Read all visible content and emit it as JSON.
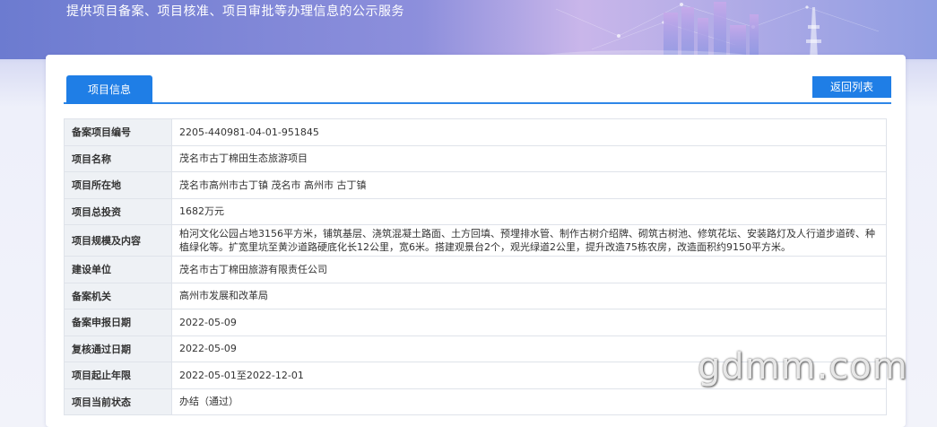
{
  "header": {
    "subtitle": "提供项目备案、项目核准、项目审批等办理信息的公示服务"
  },
  "tabs": [
    {
      "label": "项目信息",
      "active": true
    }
  ],
  "toolbar": {
    "back_label": "返回列表"
  },
  "project": {
    "rows": [
      {
        "label": "备案项目编号",
        "value": "2205-440981-04-01-951845"
      },
      {
        "label": "项目名称",
        "value": "茂名市古丁棉田生态旅游项目"
      },
      {
        "label": "项目所在地",
        "value": "茂名市高州市古丁镇 茂名市 高州市 古丁镇"
      },
      {
        "label": "项目总投资",
        "value": "1682万元"
      },
      {
        "label": "项目规模及内容",
        "value": "柏河文化公园占地3156平方米，铺筑基层、浇筑混凝土路面、土方回填、预埋排水管、制作古树介绍牌、砌筑古树池、修筑花坛、安装路灯及人行道步道砖、种植绿化等。扩宽里坑至黄沙道路硬底化长12公里，宽6米。搭建观景台2个，观光绿道2公里，提升改造75栋农房，改造面积约9150平方米。"
      },
      {
        "label": "建设单位",
        "value": "茂名市古丁棉田旅游有限责任公司"
      },
      {
        "label": "备案机关",
        "value": "高州市发展和改革局"
      },
      {
        "label": "备案申报日期",
        "value": "2022-05-09"
      },
      {
        "label": "复核通过日期",
        "value": "2022-05-09"
      },
      {
        "label": "项目起止年限",
        "value": "2022-05-01至2022-12-01"
      },
      {
        "label": "项目当前状态",
        "value": "办结（通过）"
      }
    ]
  },
  "watermark": "gdmm.com",
  "colors": {
    "accent": "#1f7ee6",
    "label_bg": "#eef1f5",
    "border": "#dfe3ea"
  }
}
